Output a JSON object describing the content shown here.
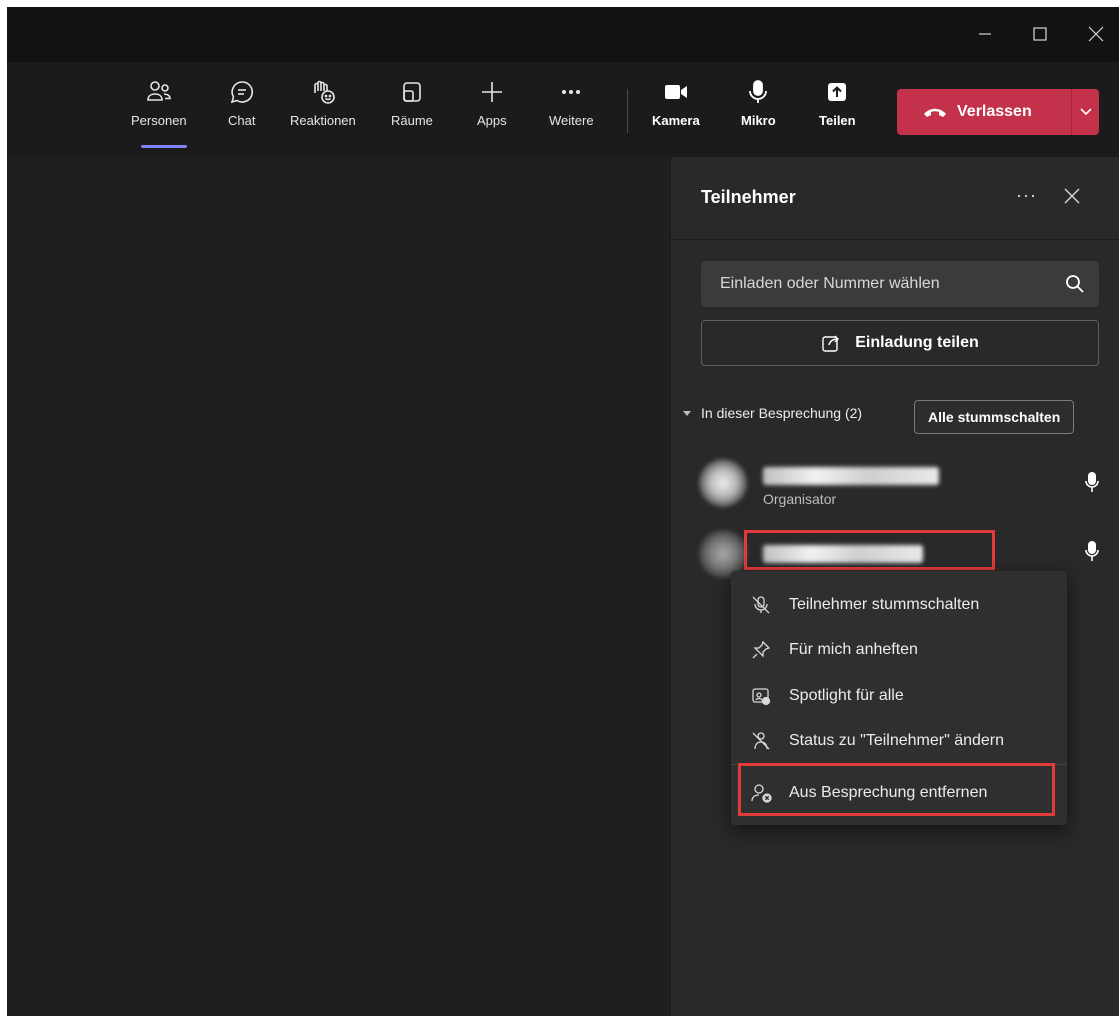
{
  "window": {
    "minimize_label": "—",
    "maximize_label": "☐",
    "close_label": "✕"
  },
  "toolbar": {
    "items": [
      {
        "label": "Personen",
        "icon": "people-icon"
      },
      {
        "label": "Chat",
        "icon": "chat-icon"
      },
      {
        "label": "Reaktionen",
        "icon": "reactions-icon"
      },
      {
        "label": "Räume",
        "icon": "rooms-icon"
      },
      {
        "label": "Apps",
        "icon": "plus-icon"
      },
      {
        "label": "Weitere",
        "icon": "more-icon"
      },
      {
        "label": "Kamera",
        "icon": "camera-icon"
      },
      {
        "label": "Mikro",
        "icon": "microphone-icon"
      },
      {
        "label": "Teilen",
        "icon": "share-screen-icon"
      }
    ],
    "leave_label": "Verlassen",
    "leave_color": "#c4314b",
    "active_indicator_color": "#7f85f5"
  },
  "panel": {
    "title": "Teilnehmer",
    "more_label": "···",
    "search_placeholder": "Einladen oder Nummer wählen",
    "share_label": "Einladung teilen",
    "section_label": "In dieser Besprechung (2)",
    "mute_all_label": "Alle stummschalten",
    "participants": [
      {
        "role": "Organisator"
      },
      {
        "role": ""
      }
    ]
  },
  "context_menu": {
    "items": [
      {
        "label": "Teilnehmer stummschalten",
        "icon": "mic-off-icon"
      },
      {
        "label": "Für mich anheften",
        "icon": "pin-icon"
      },
      {
        "label": "Spotlight für alle",
        "icon": "spotlight-icon"
      },
      {
        "label": "Status zu \"Teilnehmer\" ändern",
        "icon": "person-change-icon"
      },
      {
        "label": "Aus Besprechung entfernen",
        "icon": "person-remove-icon"
      }
    ],
    "highlight_color": "#e03a3a"
  }
}
